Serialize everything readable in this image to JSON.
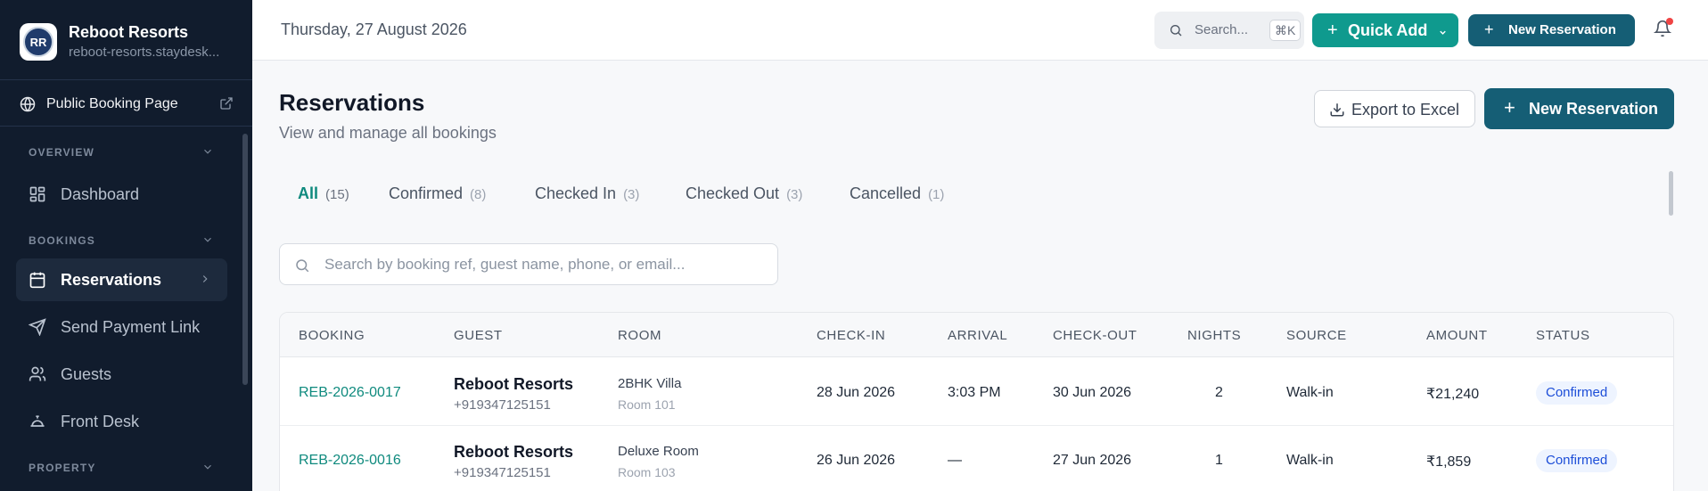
{
  "sidebar": {
    "brand": {
      "name": "Reboot Resorts",
      "subdomain": "reboot-resorts.staydesk...",
      "logo_text": "RR"
    },
    "public_link": {
      "label": "Public Booking Page"
    },
    "sections": [
      {
        "title": "OVERVIEW",
        "items": [
          {
            "label": "Dashboard",
            "icon": "dashboard-icon"
          }
        ]
      },
      {
        "title": "BOOKINGS",
        "items": [
          {
            "label": "Reservations",
            "icon": "calendar-icon",
            "active": true
          },
          {
            "label": "Send Payment Link",
            "icon": "send-icon"
          },
          {
            "label": "Guests",
            "icon": "users-icon"
          },
          {
            "label": "Front Desk",
            "icon": "bell-concierge-icon"
          }
        ]
      },
      {
        "title": "PROPERTY",
        "items": []
      }
    ]
  },
  "topbar": {
    "date": "Thursday, 27 August 2026",
    "search": {
      "label": "Search...",
      "shortcut": "⌘K"
    },
    "quick_add": "Quick Add",
    "new_reservation": "New Reservation",
    "notification_dot_color": "#ef4444"
  },
  "page": {
    "title": "Reservations",
    "subtitle": "View and manage all bookings",
    "export_label": "Export to Excel",
    "new_reservation_label": "New Reservation"
  },
  "tabs": [
    {
      "label": "All",
      "count": "(15)",
      "active": true
    },
    {
      "label": "Confirmed",
      "count": "(8)"
    },
    {
      "label": "Checked In",
      "count": "(3)"
    },
    {
      "label": "Checked Out",
      "count": "(3)"
    },
    {
      "label": "Cancelled",
      "count": "(1)"
    }
  ],
  "search": {
    "placeholder": "Search by booking ref, guest name, phone, or email..."
  },
  "table": {
    "headers": [
      "BOOKING",
      "GUEST",
      "ROOM",
      "CHECK-IN",
      "ARRIVAL",
      "CHECK-OUT",
      "NIGHTS",
      "SOURCE",
      "AMOUNT",
      "STATUS"
    ],
    "rows": [
      {
        "booking": "REB-2026-0017",
        "guest": "Reboot Resorts",
        "phone": "+919347125151",
        "room_type": "2BHK Villa",
        "room_no": "Room 101",
        "check_in": "28 Jun 2026",
        "arrival": "3:03 PM",
        "check_out": "30 Jun 2026",
        "nights": "2",
        "source": "Walk-in",
        "amount": "₹21,240",
        "status": "Confirmed"
      },
      {
        "booking": "REB-2026-0016",
        "guest": "Reboot Resorts",
        "phone": "+919347125151",
        "room_type": "Deluxe Room",
        "room_no": "Room 103",
        "check_in": "26 Jun 2026",
        "arrival": "—",
        "check_out": "27 Jun 2026",
        "nights": "1",
        "source": "Walk-in",
        "amount": "₹1,859",
        "status": "Confirmed"
      }
    ]
  },
  "colors": {
    "sidebar_bg": "#111c2d",
    "accent_teal": "#0f9a8e",
    "primary_blue": "#155e75",
    "badge_blue": "#1d4ed8"
  }
}
